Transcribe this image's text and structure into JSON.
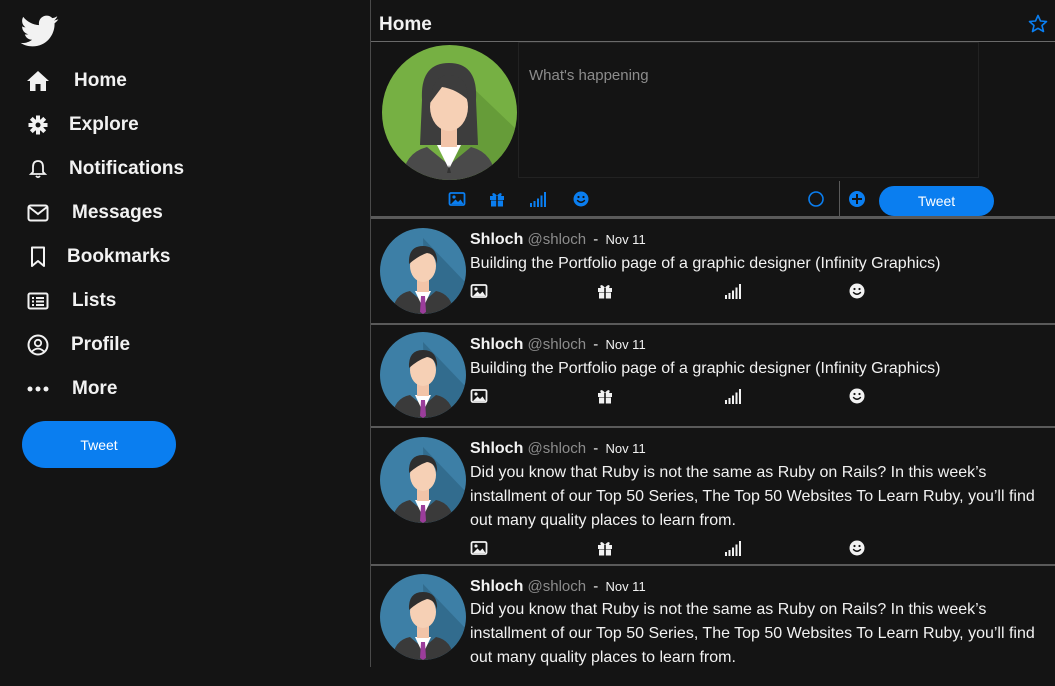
{
  "sidebar": {
    "logo": "twitter-bird-icon",
    "nav": [
      {
        "label": "Home",
        "icon": "home-icon"
      },
      {
        "label": "Explore",
        "icon": "cog-icon"
      },
      {
        "label": "Notifications",
        "icon": "bell-icon"
      },
      {
        "label": "Messages",
        "icon": "envelope-icon"
      },
      {
        "label": "Bookmarks",
        "icon": "bookmark-icon"
      },
      {
        "label": "Lists",
        "icon": "list-icon"
      },
      {
        "label": "Profile",
        "icon": "user-circle-icon"
      },
      {
        "label": "More",
        "icon": "ellipsis-icon"
      }
    ],
    "tweet_button": "Tweet"
  },
  "header": {
    "title": "Home"
  },
  "composer": {
    "placeholder": "What's happening",
    "tweet_button": "Tweet",
    "tools": [
      "image-icon",
      "gift-icon",
      "signal-icon",
      "smiley-icon"
    ]
  },
  "tweets": [
    {
      "name": "Shloch",
      "handle": "@shloch",
      "sep": "-",
      "date": "Nov 11",
      "text": "Building the Portfolio page of a graphic designer (Infinity Graphics)"
    },
    {
      "name": "Shloch",
      "handle": "@shloch",
      "sep": "-",
      "date": "Nov 11",
      "text": "Building the Portfolio page of a graphic designer (Infinity Graphics)"
    },
    {
      "name": "Shloch",
      "handle": "@shloch",
      "sep": "-",
      "date": "Nov 11",
      "text": "Did you know that Ruby is not the same as Ruby on Rails? In this week’s installment of our Top 50 Series, The Top 50 Websites To Learn Ruby, you’ll find out many quality places to learn from."
    },
    {
      "name": "Shloch",
      "handle": "@shloch",
      "sep": "-",
      "date": "Nov 11",
      "text": "Did you know that Ruby is not the same as Ruby on Rails? In this week’s installment of our Top 50 Series, The Top 50 Websites To Learn Ruby, you’ll find out many quality places to learn from."
    }
  ],
  "colors": {
    "accent": "#0a7ef0",
    "background": "#141414",
    "text": "#f2f2f2",
    "muted": "#8c8c8c"
  }
}
